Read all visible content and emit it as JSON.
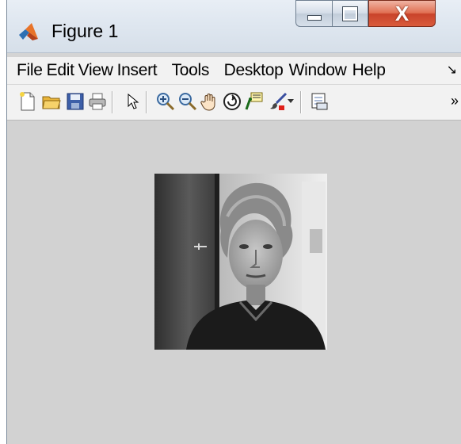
{
  "window": {
    "title": "Figure 1",
    "app_icon": "matlab-icon",
    "close_label": "X"
  },
  "menu": {
    "items": [
      "File",
      "Edit",
      "View",
      "Insert",
      "Tools",
      "Desktop",
      "Window",
      "Help"
    ]
  },
  "toolbar": {
    "tools": [
      "new-figure-icon",
      "open-file-icon",
      "save-icon",
      "print-icon",
      "select-arrow-icon",
      "zoom-in-icon",
      "zoom-out-icon",
      "pan-hand-icon",
      "rotate-3d-icon",
      "data-cursor-icon",
      "brush-icon",
      "dropdown-icon",
      "link-plot-icon",
      "overflow-icon"
    ]
  },
  "figure": {
    "content": "grayscale-portrait-image",
    "colors": {
      "figure_background": "#d2d2d2",
      "titlebar": "#dfe7f0",
      "close_button": "#d95b3c"
    }
  }
}
